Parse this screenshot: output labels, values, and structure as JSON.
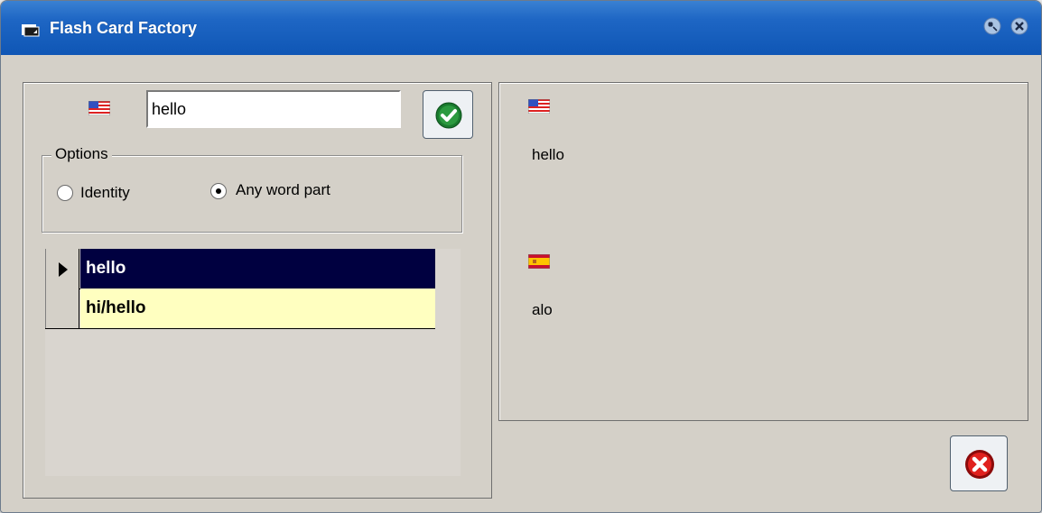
{
  "window": {
    "title": "Flash Card Factory",
    "titlebar_color": "#1e66c4",
    "icons": {
      "app": "app-window-icon",
      "settings": "settings-icon",
      "close": "close-icon"
    }
  },
  "search": {
    "language_flag": "us-flag-icon",
    "value": "hello",
    "go_icon": "checkmark-icon"
  },
  "options": {
    "legend": "Options",
    "radios": [
      {
        "label": "Identity",
        "checked": false
      },
      {
        "label": "Any word part",
        "checked": true
      }
    ]
  },
  "results": {
    "rows": [
      {
        "text": "hello",
        "selected": true
      },
      {
        "text": "hi/hello",
        "selected": false
      }
    ],
    "selected_color": "#000040",
    "row_color": "#ffffc0"
  },
  "detail": {
    "source_flag": "us-flag-icon",
    "source_text": "hello",
    "target_flag": "es-flag-icon",
    "target_text": "alo"
  },
  "footer": {
    "close_icon": "cancel-icon"
  }
}
